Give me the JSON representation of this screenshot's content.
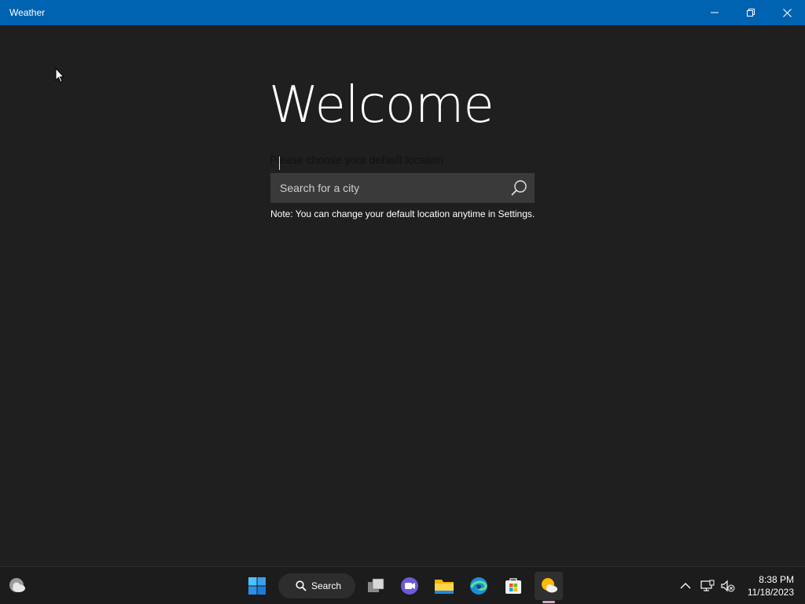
{
  "window": {
    "title": "Weather",
    "controls": [
      "minimize-icon",
      "restore-icon",
      "close-icon"
    ]
  },
  "welcome": {
    "heading": "Welcome",
    "subtitle": "Please choose your default location",
    "search_placeholder": "Search for a city",
    "search_value": "",
    "note": "Note: You can change your default location anytime in Settings."
  },
  "taskbar": {
    "search_label": "Search",
    "apps": [
      "weather-widget-icon",
      "start-icon",
      "search-icon",
      "task-view-icon",
      "teams-chat-icon",
      "file-explorer-icon",
      "edge-icon",
      "microsoft-store-icon",
      "weather-app-icon"
    ],
    "tray": [
      "chevron-up-icon",
      "network-icon",
      "volume-muted-icon"
    ],
    "time": "8:38 PM",
    "date": "11/18/2023"
  },
  "colors": {
    "titlebar": "#0063b1",
    "background": "#1f1f1f",
    "search_box": "#3a3a3a",
    "taskbar": "#1c1c1c",
    "active_indicator": "#d3a2c9"
  }
}
